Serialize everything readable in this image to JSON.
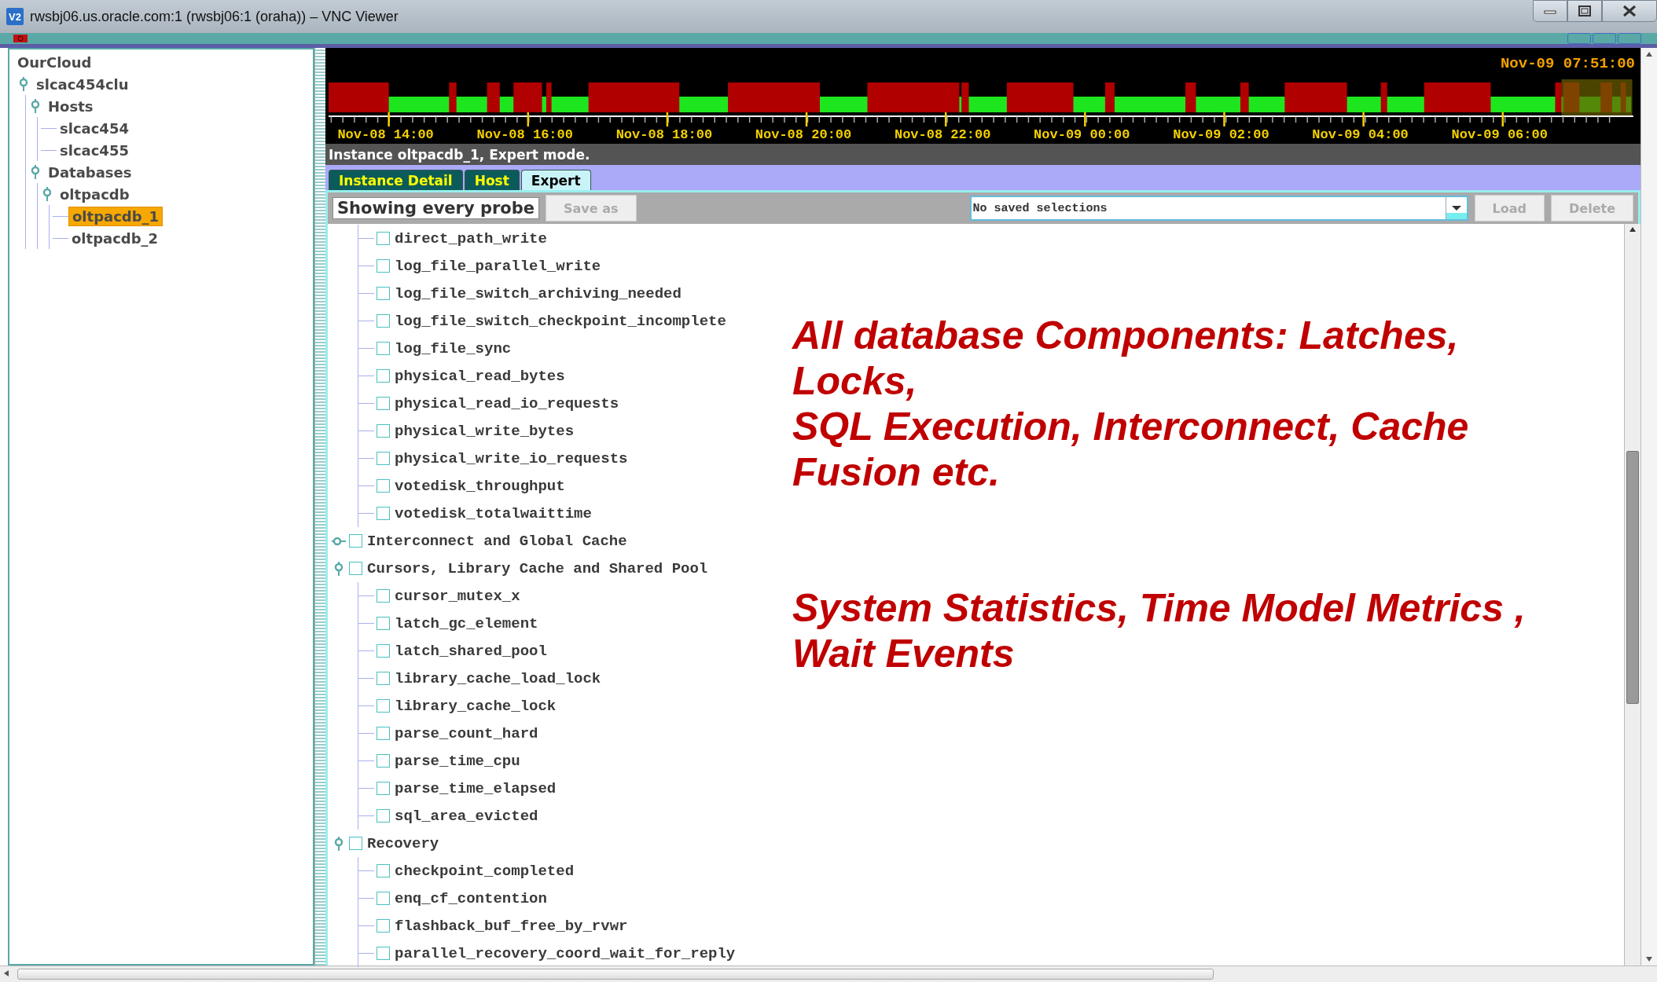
{
  "window": {
    "title": "rwsbj06.us.oracle.com:1 (rwsbj06:1 (oraha)) – VNC Viewer",
    "app_icon": "V2"
  },
  "cluster_tree": [
    {
      "label": "OurCloud",
      "selected": false,
      "children": [
        {
          "label": "slcac454clu",
          "selected": false,
          "expanded": true,
          "children": [
            {
              "label": "Hosts",
              "selected": false,
              "expanded": true,
              "children": [
                {
                  "label": "slcac454",
                  "selected": false
                },
                {
                  "label": "slcac455",
                  "selected": false
                }
              ]
            },
            {
              "label": "Databases",
              "selected": false,
              "expanded": true,
              "children": [
                {
                  "label": "oltpacdb",
                  "selected": false,
                  "expanded": true,
                  "children": [
                    {
                      "label": "oltpacdb_1",
                      "selected": true
                    },
                    {
                      "label": "oltpacdb_2",
                      "selected": false
                    }
                  ]
                }
              ]
            }
          ]
        }
      ]
    }
  ],
  "timeline": {
    "current_time": "Nov-09 07:51:00",
    "labels": [
      "Nov-08 14:00",
      "Nov-08 16:00",
      "Nov-08 18:00",
      "Nov-08 20:00",
      "Nov-08 22:00",
      "Nov-09 00:00",
      "Nov-09 02:00",
      "Nov-09 04:00",
      "Nov-09 06:00"
    ]
  },
  "status": "Instance oltpacdb_1, Expert mode.",
  "tabs": [
    {
      "label": "Instance Detail",
      "selected": false
    },
    {
      "label": "Host",
      "selected": false
    },
    {
      "label": "Expert",
      "selected": true
    }
  ],
  "toolbar": {
    "filter_label": "Showing every probe",
    "save_button": {
      "label": "Save as",
      "disabled": true
    },
    "selection_combo": {
      "value": "No saved selections"
    },
    "load_button": {
      "label": "Load",
      "disabled": true
    },
    "delete_button": {
      "label": "Delete",
      "disabled": true
    }
  },
  "probe_list": {
    "continued_items": [
      {
        "label": "direct_path_write",
        "checked": false
      },
      {
        "label": "log_file_parallel_write",
        "checked": false
      },
      {
        "label": "log_file_switch_archiving_needed",
        "checked": false
      },
      {
        "label": "log_file_switch_checkpoint_incomplete",
        "checked": false
      },
      {
        "label": "log_file_sync",
        "checked": false
      },
      {
        "label": "physical_read_bytes",
        "checked": false
      },
      {
        "label": "physical_read_io_requests",
        "checked": false
      },
      {
        "label": "physical_write_bytes",
        "checked": false
      },
      {
        "label": "physical_write_io_requests",
        "checked": false
      },
      {
        "label": "votedisk_throughput",
        "checked": false
      },
      {
        "label": "votedisk_totalwaittime",
        "checked": false
      }
    ],
    "groups": [
      {
        "label": "Interconnect and Global Cache",
        "checked": false,
        "expanded": false
      },
      {
        "label": "Cursors, Library Cache and Shared Pool",
        "checked": false,
        "expanded": true,
        "children": [
          {
            "label": "cursor_mutex_x",
            "checked": false
          },
          {
            "label": "latch_gc_element",
            "checked": false
          },
          {
            "label": "latch_shared_pool",
            "checked": false
          },
          {
            "label": "library_cache_load_lock",
            "checked": false
          },
          {
            "label": "library_cache_lock",
            "checked": false
          },
          {
            "label": "parse_count_hard",
            "checked": false
          },
          {
            "label": "parse_time_cpu",
            "checked": false
          },
          {
            "label": "parse_time_elapsed",
            "checked": false
          },
          {
            "label": "sql_area_evicted",
            "checked": false
          }
        ]
      },
      {
        "label": "Recovery",
        "checked": false,
        "expanded": true,
        "children": [
          {
            "label": "checkpoint_completed",
            "checked": false
          },
          {
            "label": "enq_cf_contention",
            "checked": false
          },
          {
            "label": "flashback_buf_free_by_rvwr",
            "checked": false
          },
          {
            "label": "parallel_recovery_coord_wait_for_reply",
            "checked": false
          }
        ]
      }
    ]
  },
  "annotations": [
    {
      "lines": [
        "All database Components: Latches,",
        "Locks,",
        "SQL Execution, Interconnect, Cache",
        "Fusion etc."
      ]
    },
    {
      "lines": [
        "System Statistics, Time Model Metrics ,",
        "Wait Events"
      ]
    }
  ]
}
